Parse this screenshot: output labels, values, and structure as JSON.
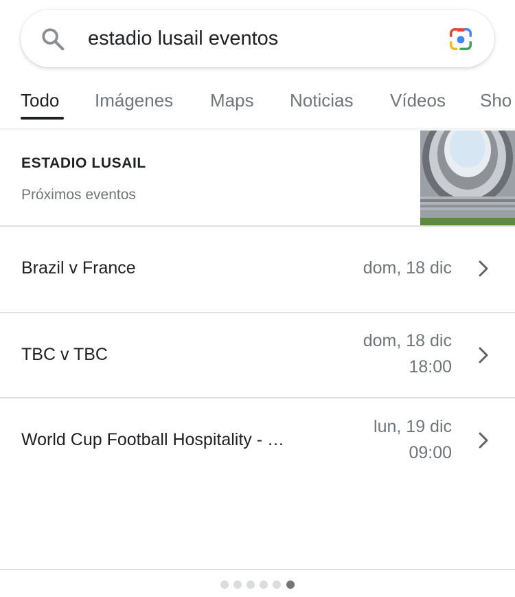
{
  "search": {
    "query": "estadio lusail eventos",
    "search_icon": "search-icon",
    "lens_icon": "google-lens-icon"
  },
  "tabs": [
    {
      "label": "Todo",
      "active": true
    },
    {
      "label": "Imágenes",
      "active": false
    },
    {
      "label": "Maps",
      "active": false
    },
    {
      "label": "Noticias",
      "active": false
    },
    {
      "label": "Vídeos",
      "active": false
    },
    {
      "label": "Sho",
      "active": false
    }
  ],
  "venue": {
    "title": "ESTADIO LUSAIL",
    "subtitle": "Próximos eventos",
    "thumbnail": "stadium-image"
  },
  "events": [
    {
      "name": "Brazil v France",
      "date": "dom, 18 dic",
      "time": ""
    },
    {
      "name": "TBC v TBC",
      "date": "dom, 18 dic",
      "time": "18:00"
    },
    {
      "name": "World Cup Football Hospitality - …",
      "date": "lun, 19 dic",
      "time": "09:00"
    }
  ],
  "pagination": {
    "pages": 6,
    "current": 6
  },
  "colors": {
    "text_primary": "#202124",
    "text_secondary": "#70757a",
    "divider": "#e0e0e0",
    "dot_inactive": "#dadce0",
    "dot_active": "#757575"
  }
}
